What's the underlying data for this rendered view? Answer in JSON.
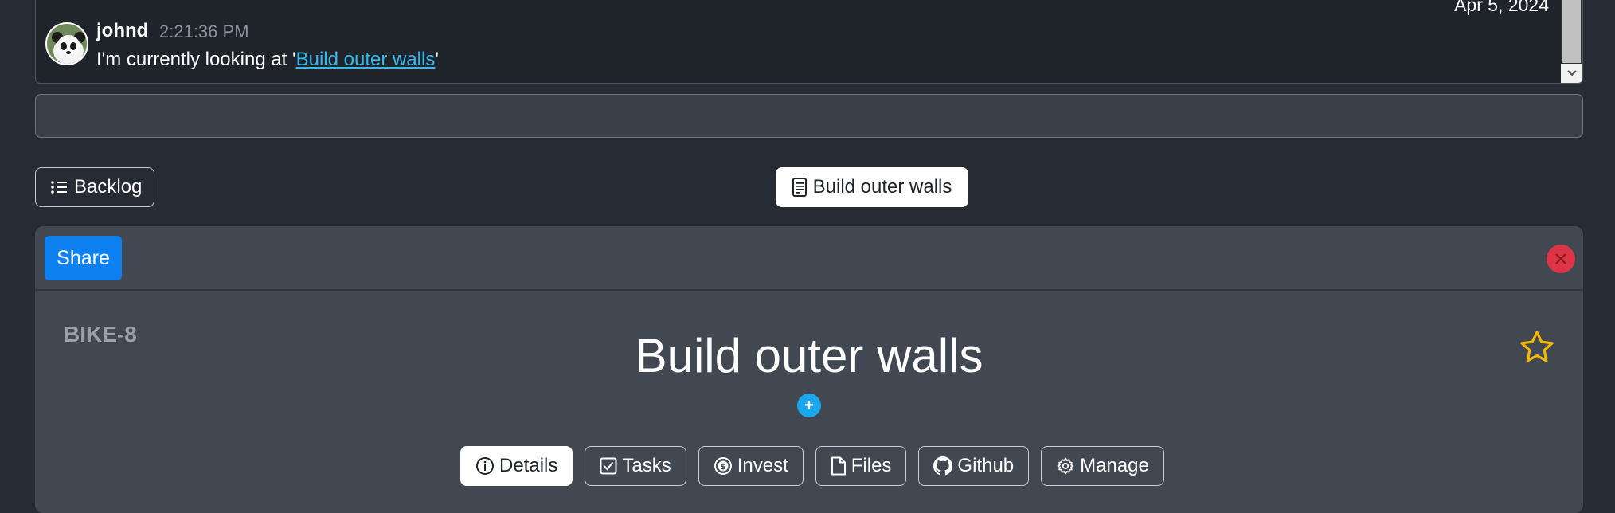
{
  "chat": {
    "date": "Apr 5, 2024",
    "message": {
      "user": "johnd",
      "time": "2:21:36 PM",
      "text_prefix": "I'm currently looking at '",
      "link": "Build outer walls",
      "text_suffix": "'"
    },
    "input_value": "",
    "input_placeholder": ""
  },
  "nav": {
    "backlog_label": "Backlog",
    "breadcrumb_label": "Build outer walls"
  },
  "issue": {
    "share_label": "Share",
    "key": "BIKE-8",
    "title": "Build outer walls",
    "add_label": "+",
    "tabs": [
      {
        "label": "Details",
        "icon": "info-icon",
        "active": true
      },
      {
        "label": "Tasks",
        "icon": "checkbox-icon",
        "active": false
      },
      {
        "label": "Invest",
        "icon": "coin-icon",
        "active": false
      },
      {
        "label": "Files",
        "icon": "file-icon",
        "active": false
      },
      {
        "label": "Github",
        "icon": "github-icon",
        "active": false
      },
      {
        "label": "Manage",
        "icon": "gear-icon",
        "active": false
      }
    ]
  },
  "colors": {
    "background": "#272b33",
    "card": "#424852",
    "primary": "#0d80f2",
    "danger": "#dc3545",
    "star": "#f5b700",
    "link": "#38b9ee"
  }
}
